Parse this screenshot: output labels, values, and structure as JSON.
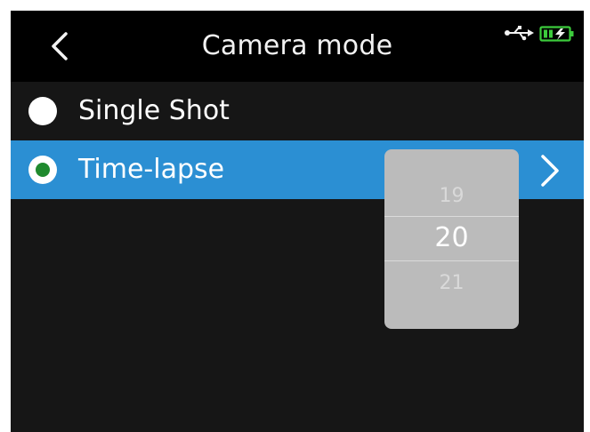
{
  "header": {
    "title": "Camera mode",
    "icons": {
      "back": "chevron-left-icon",
      "usb": "usb-icon",
      "battery": "battery-charging-icon"
    }
  },
  "menu": {
    "items": [
      {
        "label": "Single Shot",
        "selected": false
      },
      {
        "label": "Time-lapse",
        "selected": true
      }
    ]
  },
  "picker": {
    "previous": "19",
    "current": "20",
    "next": "21"
  },
  "colors": {
    "background": "#161616",
    "header_background": "#000000",
    "highlight": "#2b8fd3",
    "radio_selected": "#1f8a2e",
    "battery": "#3ccb3c",
    "picker_background": "#bbbbbb"
  }
}
